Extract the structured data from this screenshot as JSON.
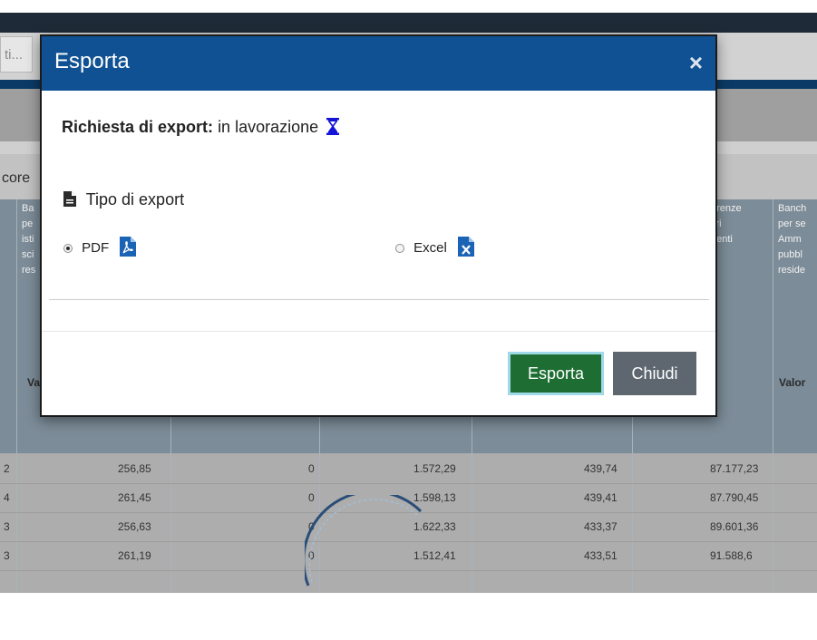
{
  "background": {
    "filter_chip": "ti...",
    "section_label": "core",
    "table_headers": {
      "left": [
        "Ba",
        "pe",
        "isti",
        "sci",
        "res"
      ],
      "mid": [
        "erenze",
        "ltri",
        "denti"
      ],
      "right": [
        "Banch",
        "per se",
        "Amm",
        "pubbl",
        "reside"
      ]
    },
    "value_headers": {
      "left": "Va",
      "right": "Valor"
    },
    "rows": [
      {
        "lead": "2",
        "c1": "256,85",
        "c2": "0",
        "c3": "1.572,29",
        "c4": "439,74",
        "c5": "87.177,23"
      },
      {
        "lead": "4",
        "c1": "261,45",
        "c2": "0",
        "c3": "1.598,13",
        "c4": "439,41",
        "c5": "87.790,45"
      },
      {
        "lead": "3",
        "c1": "256,63",
        "c2": "0",
        "c3": "1.622,33",
        "c4": "433,37",
        "c5": "89.601,36"
      },
      {
        "lead": "3",
        "c1": "261,19",
        "c2": "0",
        "c3": "1.512,41",
        "c4": "433,51",
        "c5": "91.588,6"
      }
    ]
  },
  "modal": {
    "title": "Esporta",
    "close_symbol": "×",
    "request_label": "Richiesta di export:",
    "request_status": "in lavorazione",
    "export_type_label": "Tipo di export",
    "options": [
      {
        "label": "PDF",
        "selected": true,
        "icon": "pdf-file-icon"
      },
      {
        "label": "Excel",
        "selected": false,
        "icon": "excel-file-icon"
      }
    ],
    "buttons": {
      "export": "Esporta",
      "close": "Chiudi"
    }
  },
  "colors": {
    "header_blue": "#0f5192",
    "export_green": "#1e6e34",
    "close_gray": "#5e6770",
    "icon_blue": "#1b63b4"
  }
}
